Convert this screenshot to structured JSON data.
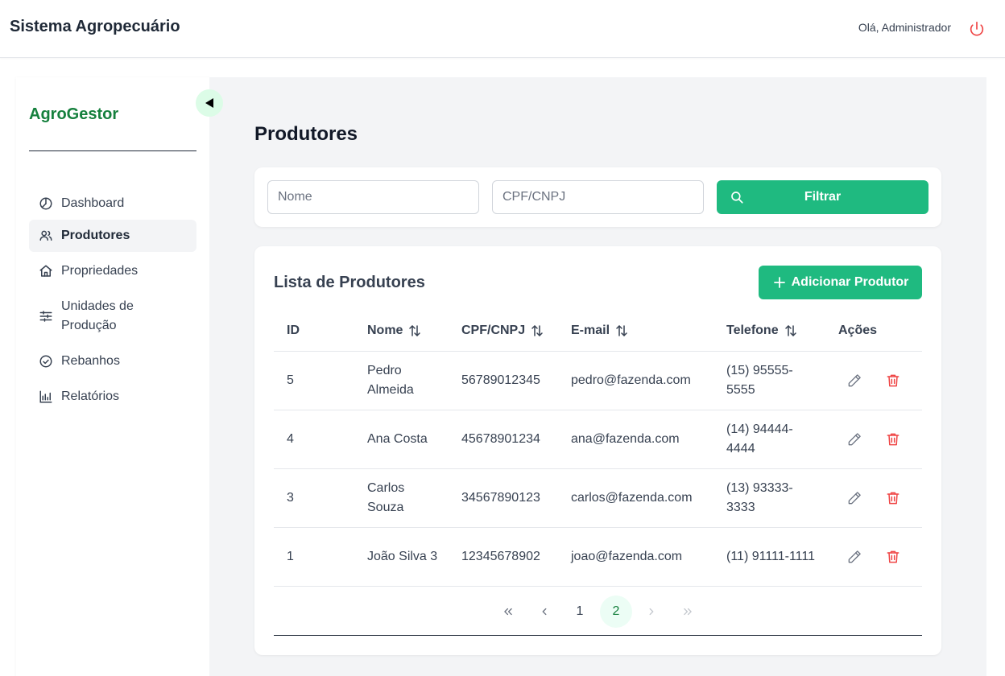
{
  "header": {
    "title": "Sistema Agropecuário",
    "greeting": "Olá, Administrador",
    "power_icon": "power-icon"
  },
  "sidebar": {
    "brand": "AgroGestor",
    "collapse_icon": "triangle-left-icon",
    "items": [
      {
        "label": "Dashboard",
        "icon": "dashboard-icon",
        "active": false
      },
      {
        "label": "Produtores",
        "icon": "users-icon",
        "active": true
      },
      {
        "label": "Propriedades",
        "icon": "home-icon",
        "active": false
      },
      {
        "label": "Unidades de Produção",
        "icon": "sliders-icon",
        "active": false
      },
      {
        "label": "Rebanhos",
        "icon": "check-circle-icon",
        "active": false
      },
      {
        "label": "Relatórios",
        "icon": "bar-chart-icon",
        "active": false
      }
    ]
  },
  "main": {
    "page_title": "Produtores",
    "filter": {
      "name_placeholder": "Nome",
      "doc_placeholder": "CPF/CNPJ",
      "button_label": "Filtrar"
    },
    "list": {
      "title": "Lista de Produtores",
      "add_button_label": "Adicionar Produtor",
      "columns": [
        "ID",
        "Nome",
        "CPF/CNPJ",
        "E-mail",
        "Telefone",
        "Ações"
      ],
      "rows": [
        {
          "id": "5",
          "name": "Pedro Almeida",
          "doc": "56789012345",
          "email": "pedro@fazenda.com",
          "phone": "(15) 95555-5555"
        },
        {
          "id": "4",
          "name": "Ana Costa",
          "doc": "45678901234",
          "email": "ana@fazenda.com",
          "phone": "(14) 94444-4444"
        },
        {
          "id": "3",
          "name": "Carlos Souza",
          "doc": "34567890123",
          "email": "carlos@fazenda.com",
          "phone": "(13) 93333-3333"
        },
        {
          "id": "1",
          "name": "João Silva 3",
          "doc": "12345678902",
          "email": "joao@fazenda.com",
          "phone": "(11) 91111-1111"
        }
      ]
    },
    "pagination": {
      "pages": [
        "1",
        "2"
      ],
      "current": "2"
    }
  },
  "colors": {
    "accent": "#1fba80",
    "brand": "#15803d",
    "danger": "#ef4444",
    "background": "#f3f4f6"
  }
}
